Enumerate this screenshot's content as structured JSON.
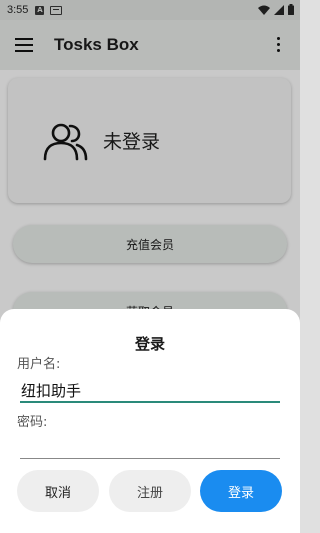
{
  "status_bar": {
    "time": "3:55",
    "notif_letter": "A"
  },
  "app_bar": {
    "title": "Tosks Box"
  },
  "user_card": {
    "status": "未登录"
  },
  "buttons": {
    "recharge": "充值会员",
    "get_member": "获取会员"
  },
  "login_dialog": {
    "title": "登录",
    "username_label": "用户名:",
    "username_value": "纽扣助手",
    "password_label": "密码:",
    "password_value": "",
    "cancel": "取消",
    "register": "注册",
    "login": "登录"
  },
  "colors": {
    "accent_underline": "#2a8a7a",
    "login_button": "#1a8cf0"
  }
}
